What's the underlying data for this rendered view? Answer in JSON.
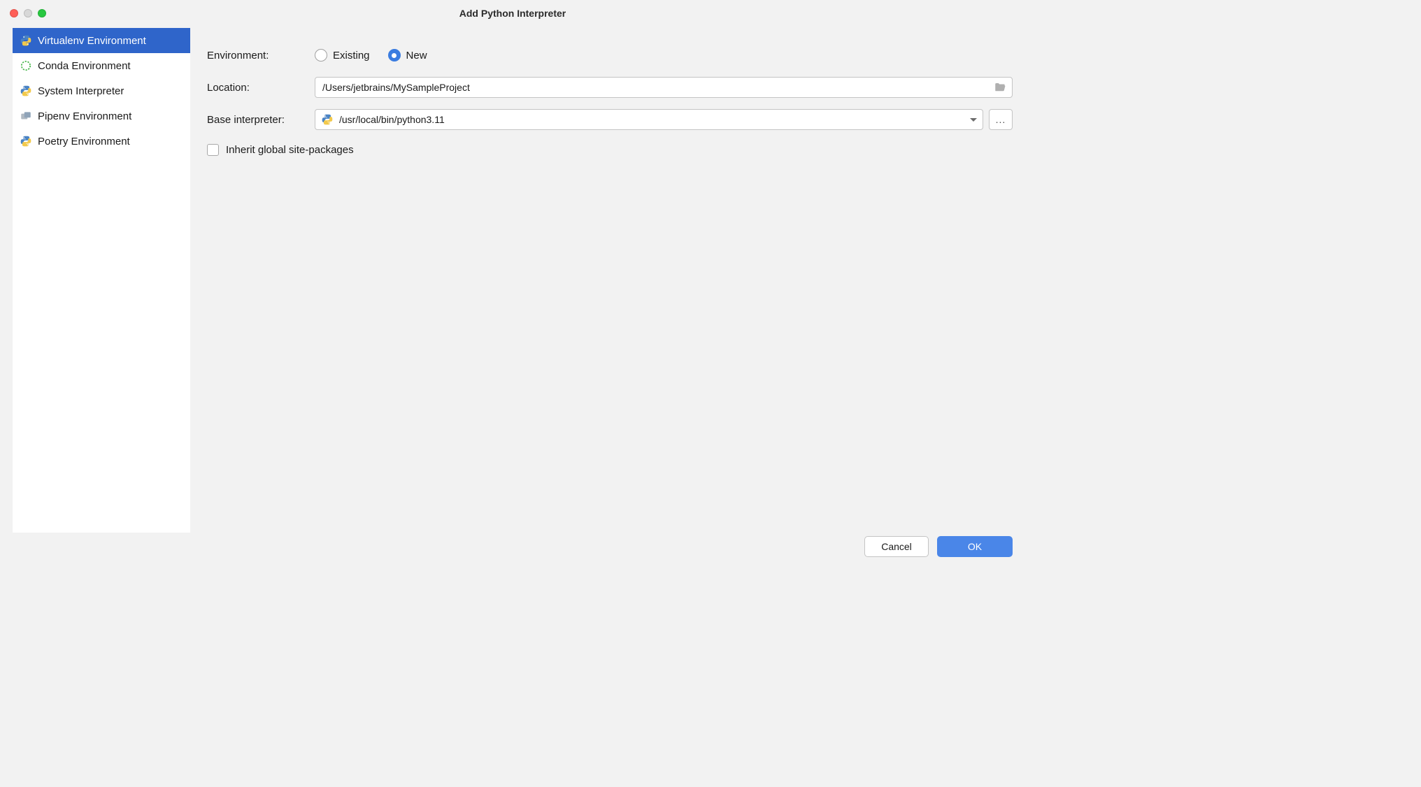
{
  "title": "Add Python Interpreter",
  "sidebar": {
    "items": [
      {
        "label": "Virtualenv Environment"
      },
      {
        "label": "Conda Environment"
      },
      {
        "label": "System Interpreter"
      },
      {
        "label": "Pipenv Environment"
      },
      {
        "label": "Poetry Environment"
      }
    ]
  },
  "form": {
    "environment_label": "Environment:",
    "radio_existing": "Existing",
    "radio_new": "New",
    "location_label": "Location:",
    "location_value": "/Users/jetbrains/MySampleProject",
    "base_interpreter_label": "Base interpreter:",
    "base_interpreter_value": "/usr/local/bin/python3.11",
    "browse_label": "...",
    "inherit_label": "Inherit global site-packages"
  },
  "footer": {
    "cancel": "Cancel",
    "ok": "OK"
  }
}
